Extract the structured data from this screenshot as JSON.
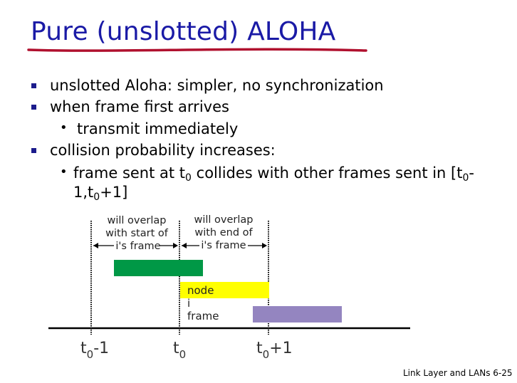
{
  "title": "Pure (unslotted) ALOHA",
  "bullets": {
    "b1": "unslotted Aloha: simpler, no synchronization",
    "b2": "when frame first arrives",
    "b2_sub": "transmit immediately",
    "b3": "collision probability increases:",
    "b3_sub_pre": "frame sent at t",
    "b3_sub_sub1": "0",
    "b3_sub_mid": " collides with other frames sent in [t",
    "b3_sub_sub2": "0",
    "b3_sub_end": "-",
    "b3_sub_line2_pre": "1,t",
    "b3_sub_line2_sub": "0",
    "b3_sub_line2_end": "+1]"
  },
  "diagram": {
    "label_left": "will overlap\nwith start of\ni's frame",
    "label_right": "will overlap\nwith end of\ni's frame",
    "frame_label": "node i frame",
    "tick_left": "t",
    "tick_left_sub": "0",
    "tick_left_suffix": "-1",
    "tick_mid": "t",
    "tick_mid_sub": "0",
    "tick_right": "t",
    "tick_right_sub": "0",
    "tick_right_suffix": "+1",
    "colors": {
      "green_frame": "#009846",
      "yellow_frame": "#ffff00",
      "purple_frame": "#9485c0"
    }
  },
  "footer": "Link Layer and LANs  6-25"
}
